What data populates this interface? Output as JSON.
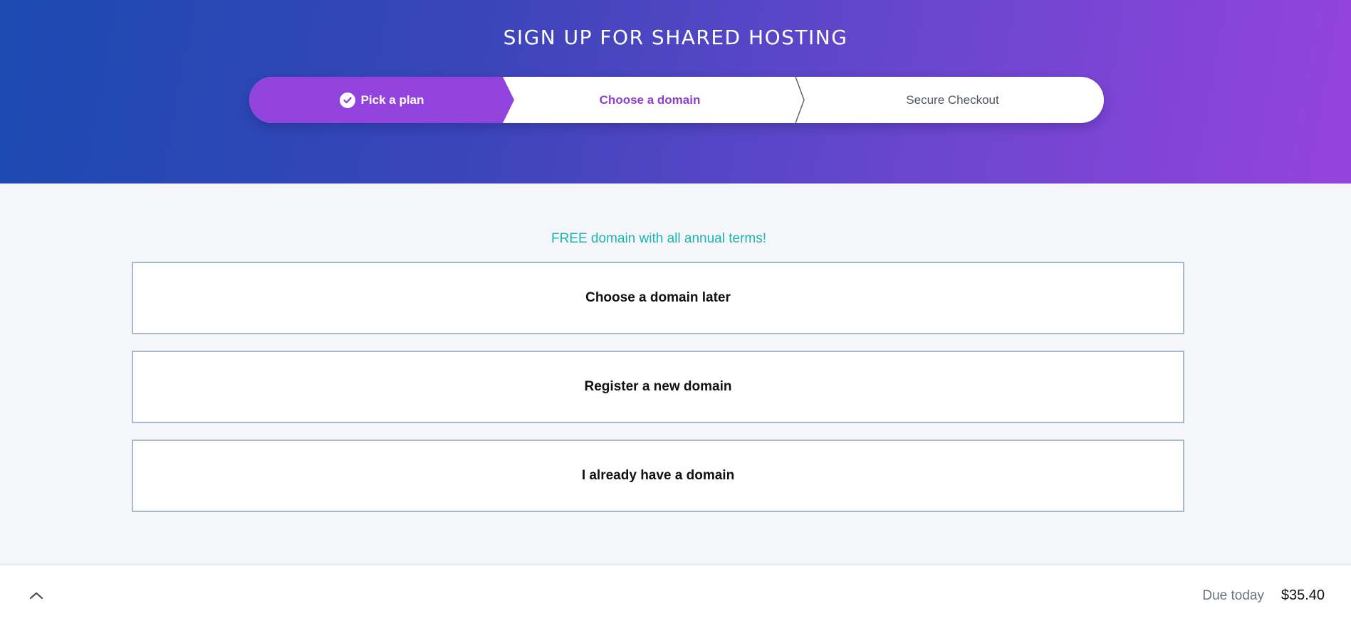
{
  "header": {
    "title": "SIGN UP FOR SHARED HOSTING"
  },
  "steps": [
    {
      "label": "Pick a plan",
      "state": "completed",
      "icon": "check-circle-icon"
    },
    {
      "label": "Choose a domain",
      "state": "current"
    },
    {
      "label": "Secure Checkout",
      "state": "upcoming"
    }
  ],
  "promo": "FREE domain with all annual terms!",
  "options": [
    {
      "label": "Choose a domain later"
    },
    {
      "label": "Register a new domain"
    },
    {
      "label": "I already have a domain"
    }
  ],
  "footer": {
    "toggle_icon": "chevron-up-icon",
    "due_label": "Due today",
    "due_amount": "$35.40"
  },
  "colors": {
    "accent_purple": "#9243dd",
    "header_gradient_start": "#1b4ab1",
    "header_gradient_end": "#9543dd",
    "promo_teal": "#1db5b0"
  }
}
